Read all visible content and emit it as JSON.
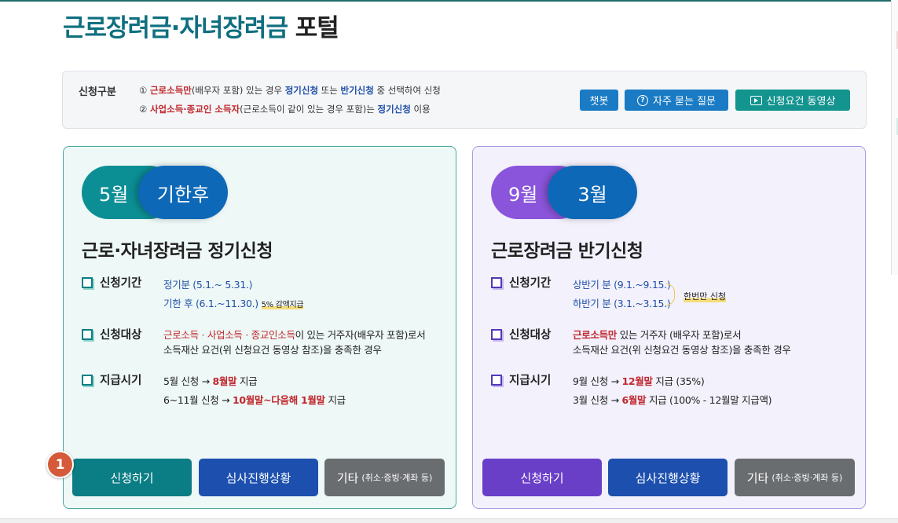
{
  "title": {
    "part1": "근로장려금·자녀장려금",
    "part2": "포털"
  },
  "info": {
    "label": "신청구분",
    "line1": {
      "num": "①",
      "red": "근로소득만",
      "t1": "(배우자 포함) 있는 경우 ",
      "b1": "정기신청",
      "t2": " 또는 ",
      "b2": "반기신청",
      "t3": " 중 선택하여 신청"
    },
    "line2": {
      "num": "②",
      "red": "사업소득·종교인 소득자",
      "t1": "(근로소득이 같이 있는 경우 포함)는 ",
      "b1": "정기신청",
      "t2": " 이용"
    },
    "buttons": {
      "chatbot": "챗봇",
      "faq": "자주 묻는 질문",
      "video": "신청요건 동영상"
    }
  },
  "left": {
    "pill_a": "5월",
    "pill_b": "기한후",
    "title": "근로·자녀장려금 정기신청",
    "period_label": "신청기간",
    "period_1": "정기분 (5.1.~ 5.31.)",
    "period_2": "기한 후 (6.1.~11.30.)",
    "period_2_note": "5% 감액지급",
    "target_label": "신청대상",
    "target_red": "근로소득 · 사업소득 · 종교인소득",
    "target_1": "이 있는 거주자(배우자 포함)로서",
    "target_2": "소득재산 요건(위 신청요건 동영상 참조)을 충족한 경우",
    "pay_label": "지급시기",
    "pay1_a": "5월 신청 → ",
    "pay1_red": "8월말",
    "pay1_b": " 지급",
    "pay2_a": "6~11월 신청 → ",
    "pay2_red": "10월말~다음해 1월말",
    "pay2_b": " 지급",
    "btn_apply": "신청하기",
    "btn_status": "심사진행상황",
    "btn_etc": "기타",
    "btn_etc_sub": "(취소·증빙·계좌 등)"
  },
  "right": {
    "pill_a": "9월",
    "pill_b": "3월",
    "title": "근로장려금 반기신청",
    "period_label": "신청기간",
    "period_1": "상반기 분 (9.1.~9.15.)",
    "period_2": "하반기 분 (3.1.~3.15.)",
    "brace_note": "한번만 신청",
    "target_label": "신청대상",
    "target_red": "근로소득만",
    "target_1": " 있는 거주자 (배우자 포함)로서",
    "target_2": "소득재산 요건(위 신청요건 동영상 참조)을 충족한 경우",
    "pay_label": "지급시기",
    "pay1_a": "9월 신청 → ",
    "pay1_red": "12월말",
    "pay1_b": " 지급 (35%)",
    "pay2_a": "3월 신청 → ",
    "pay2_red": "6월말",
    "pay2_b": " 지급 (100% - 12월말 지급액)",
    "btn_apply": "신청하기",
    "btn_status": "심사진행상황",
    "btn_etc": "기타",
    "btn_etc_sub": "(취소·증빙·계좌 등)"
  },
  "badge": "1"
}
